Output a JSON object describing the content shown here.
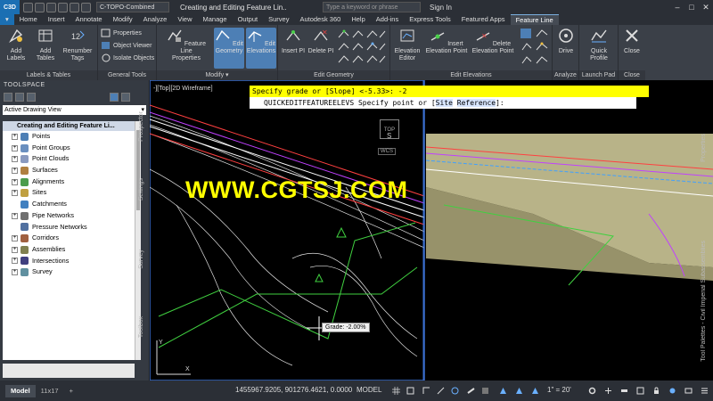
{
  "app": {
    "logo": "C3D",
    "file_title": "C-TOPO-Combined",
    "window_title": "Creating and Editing Feature Lin...",
    "search_placeholder": "Type a keyword or phrase",
    "sign_in": "Sign In"
  },
  "tabs": [
    "Home",
    "Insert",
    "Annotate",
    "Modify",
    "Analyze",
    "View",
    "Manage",
    "Output",
    "Survey",
    "Autodesk 360",
    "Help",
    "Add-ins",
    "Express Tools",
    "Featured Apps",
    "Feature Line"
  ],
  "active_tab": "Feature Line",
  "ribbon": {
    "labels_tables": {
      "title": "Labels & Tables",
      "add_labels": "Add Labels",
      "add_tables": "Add Tables",
      "renumber_tags": "Renumber Tags"
    },
    "general_tools": {
      "title": "General Tools",
      "properties": "Properties",
      "object_viewer": "Object Viewer",
      "isolate_objects": "Isolate Objects"
    },
    "modify": {
      "title": "Modify",
      "feature_line_properties": "Feature Line Properties",
      "edit_geometry": "Edit Geometry",
      "edit_elevations": "Edit Elevations"
    },
    "edit_geometry": {
      "title": "Edit Geometry",
      "insert_pi": "Insert PI",
      "delete_pi": "Delete PI"
    },
    "edit_elevations": {
      "title": "Edit Elevations",
      "elevation_editor": "Elevation Editor",
      "insert_elevation_point": "Insert Elevation Point",
      "delete_elevation_point": "Delete Elevation Point"
    },
    "analyze": {
      "title": "Analyze",
      "drive": "Drive"
    },
    "launch_pad": {
      "title": "Launch Pad",
      "quick_profile": "Quick Profile"
    },
    "close": {
      "title": "Close",
      "close": "Close"
    }
  },
  "toolspace": {
    "title": "TOOLSPACE",
    "dropdown": "Active Drawing View",
    "root": "Creating and Editing Feature Li...",
    "items": [
      "Points",
      "Point Groups",
      "Point Clouds",
      "Surfaces",
      "Alignments",
      "Sites",
      "Catchments",
      "Pipe Networks",
      "Pressure Networks",
      "Corridors",
      "Assemblies",
      "Intersections",
      "Survey"
    ],
    "side_tabs": [
      "Prospector",
      "Settings",
      "Survey",
      "Toolbox"
    ]
  },
  "drawing": {
    "view_label": "-][Top][2D Wireframe]",
    "command_line_1": "Specify grade or [Slope] <-5.33>: -2",
    "command_prefix": "QUICKEDITFEATUREELEVS Specify point or [",
    "command_opt1": "Site",
    "command_opt2": "Reference",
    "command_suffix": "]:",
    "watermark": "WWW.CGTSJ.COM",
    "grade_tooltip": "Grade: -2.00%",
    "viewcube_top": "TOP",
    "viewcube_s": "S",
    "wcs": "WCS",
    "right_tabs": [
      "Properties",
      "Tool Palettes - Civil Imperial Subassemblies"
    ]
  },
  "status": {
    "layouts": [
      "Model",
      "11x17"
    ],
    "add_layout": "+",
    "coords": "1455967.9205, 901276.4621, 0.0000",
    "model": "MODEL",
    "scale": "1\" = 20'"
  },
  "colors": {
    "accent": "#1b6fb3",
    "command_highlight": "#ffff00",
    "terrain_tan": "#d8d2a0"
  }
}
